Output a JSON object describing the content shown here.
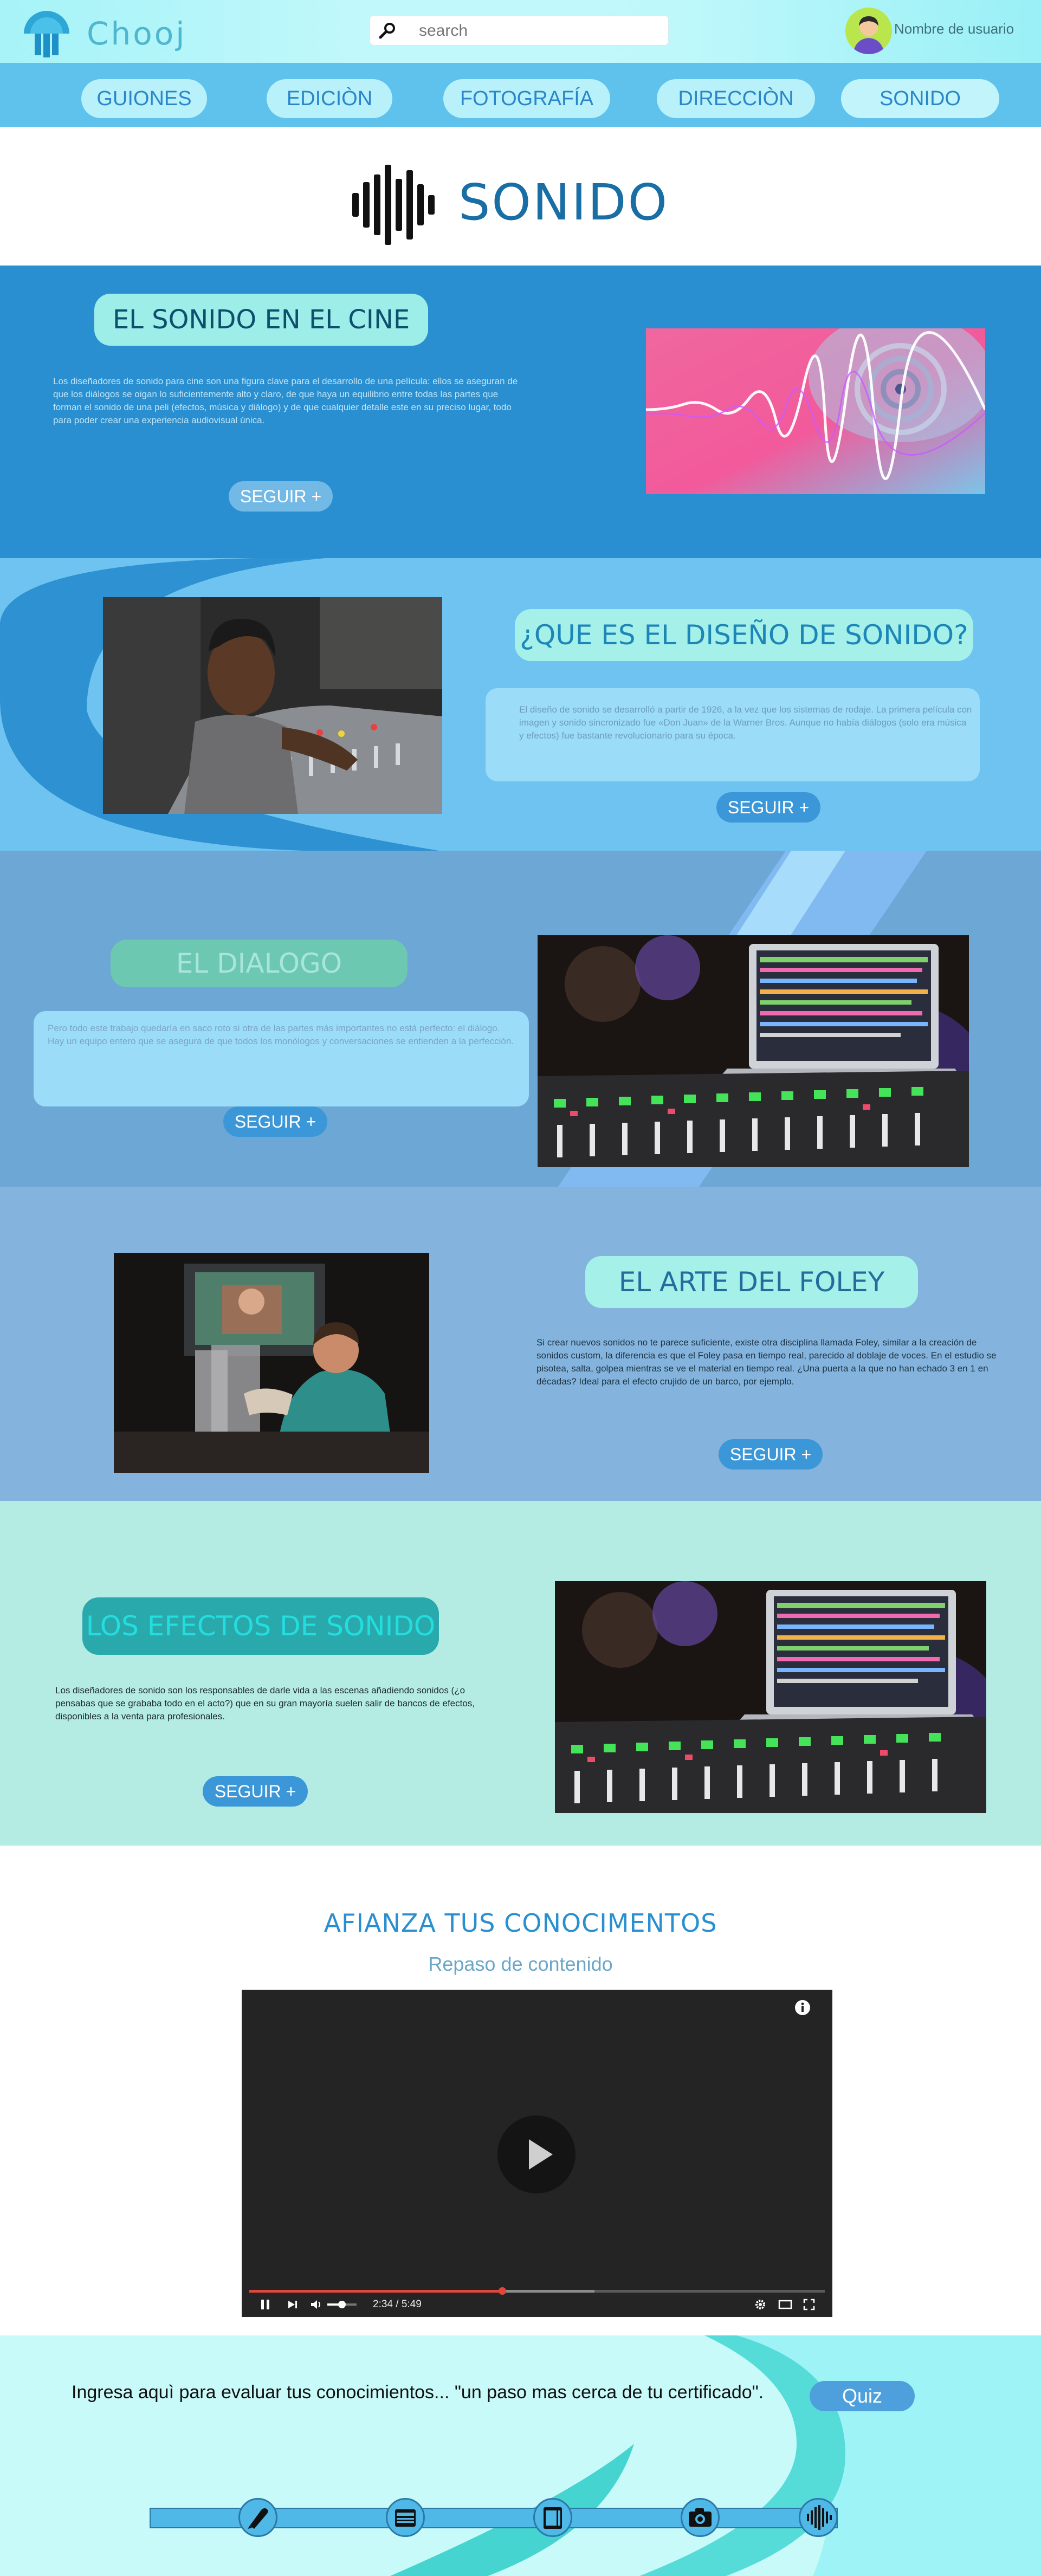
{
  "header": {
    "logo_text": "Chooj",
    "search_placeholder": "search",
    "user_name": "Nombre de usuario"
  },
  "nav": {
    "items": [
      "GUIONES",
      "EDICIÒN",
      "FOTOGRAFÍA",
      "DIRECCIÒN",
      "SONIDO"
    ]
  },
  "hero": {
    "title": "SONIDO"
  },
  "sections": {
    "cine": {
      "title": "EL SONIDO EN EL CINE",
      "text": "Los diseñadores de sonido para cine son una figura clave para el desarrollo de una película: ellos se aseguran de que los diálogos se oigan lo suficientemente alto y claro, de que haya un equilibrio entre todas las partes que forman el sonido de una peli (efectos, música y diálogo) y de que cualquier detalle este en su preciso lugar, todo para poder crear una experiencia audiovisual única.",
      "button": "SEGUIR +"
    },
    "diseno": {
      "title": "¿QUE ES EL DISEÑO DE SONIDO?",
      "text": "El diseño de sonido se desarrolló a partir de 1926, a la vez que los sistemas de rodaje. La primera película con imagen y sonido sincronizado fue «Don Juan» de la Warner Bros. Aunque no había diálogos (solo era música y efectos) fue bastante revolucionario para su época.",
      "button": "SEGUIR +"
    },
    "dialogo": {
      "title": "EL DIALOGO",
      "text": "Pero todo este trabajo quedaría en saco roto si otra de las partes más importantes no está perfecto: el diálogo. Hay un equipo entero que se asegura de que todos los monólogos y conversaciones se entienden a la perfección.",
      "button": "SEGUIR +"
    },
    "foley": {
      "title": "EL ARTE DEL FOLEY",
      "text": "Si crear nuevos sonidos no te parece suficiente, existe otra disciplina llamada Foley, similar a la creación de sonidos custom, la diferencia es que el Foley pasa en tiempo real, parecido al doblaje de voces. En el estudio se pisotea, salta, golpea mientras se ve el material en tiempo real. ¿Una puerta a la que no han echado 3 en 1 en décadas? Ideal para el efecto crujido de un barco, por ejemplo.",
      "button": "SEGUIR +"
    },
    "efectos": {
      "title": "LOS EFECTOS DE SONIDO",
      "text": "Los diseñadores de sonido son los responsables de darle vida a las escenas añadiendo sonidos (¿o pensabas que se grababa todo en el acto?) que en su gran mayoría suelen salir de bancos de efectos, disponibles a la venta para profesionales.",
      "button": "SEGUIR +"
    }
  },
  "video_section": {
    "title": "AFIANZA TUS CONOCIMENTOS",
    "subtitle": "Repaso de contenido",
    "time": "2:34 / 5:49",
    "progress": 0.44,
    "buffered": 0.6
  },
  "footer": {
    "quiz_text": "Ingresa aquì para evaluar tus conocimientos... \"un paso mas cerca de tu certificado\".",
    "quiz_button": "Quiz",
    "steps": [
      "pen-icon",
      "film-clapper-icon",
      "editing-icon",
      "camera-icon",
      "sound-wave-icon"
    ]
  },
  "colors": {
    "header_bg": "#bff8fb",
    "nav_bg": "#5fc2ec",
    "nav_pill": "#b9f1fa",
    "accent_blue": "#186ea5",
    "section_cine": "#2a8fd0",
    "section_diseno": "#6ec3f1",
    "section_dialogo": "#6da7d5",
    "section_foley": "#84b4dd",
    "section_efectos": "#b4ebe3"
  }
}
